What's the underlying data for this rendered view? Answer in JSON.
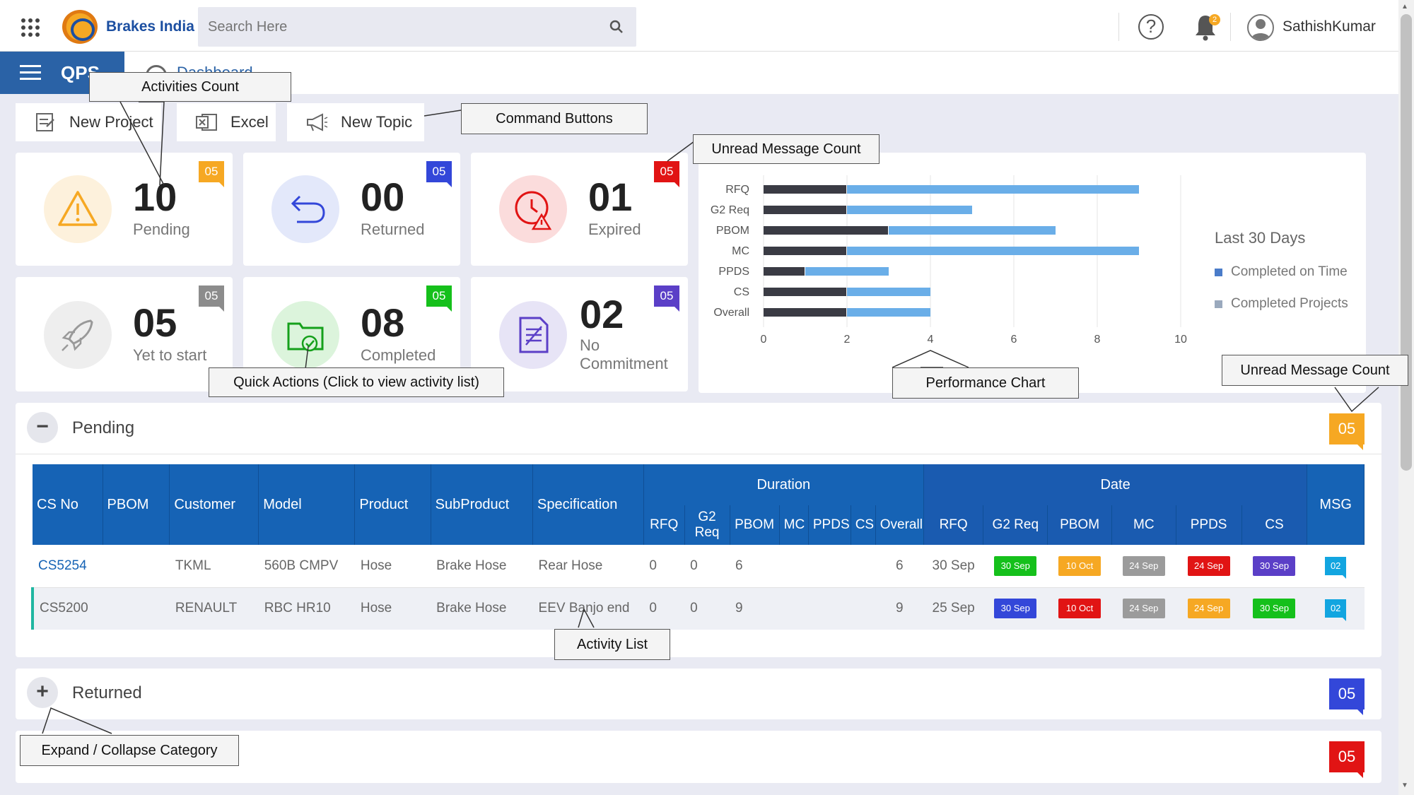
{
  "header": {
    "brand": "Brakes India",
    "search_placeholder": "Search Here",
    "notification_count": "2",
    "user_name": "SathishKumar"
  },
  "subbar": {
    "app_name": "QPS",
    "page_title": "Dashboard"
  },
  "commands": [
    {
      "label": "New Project",
      "icon": "new-project-icon"
    },
    {
      "label": "Excel",
      "icon": "excel-icon"
    },
    {
      "label": "New Topic",
      "icon": "megaphone-icon"
    }
  ],
  "cards": [
    {
      "count": "10",
      "label": "Pending",
      "badge": "05",
      "badge_color": "#f6a823",
      "circle_color": "#fdf1dc",
      "icon": "warning-icon"
    },
    {
      "count": "00",
      "label": "Returned",
      "badge": "05",
      "badge_color": "#3347d9",
      "circle_color": "#e3e8fa",
      "icon": "return-icon"
    },
    {
      "count": "01",
      "label": "Expired",
      "badge": "05",
      "badge_color": "#e11414",
      "circle_color": "#fbdcdc",
      "icon": "expired-clock-icon"
    },
    {
      "count": "05",
      "label": "Yet to start",
      "badge": "05",
      "badge_color": "#8c8c8c",
      "circle_color": "#eeeeee",
      "icon": "rocket-icon"
    },
    {
      "count": "08",
      "label": "Completed",
      "badge": "05",
      "badge_color": "#15c01b",
      "circle_color": "#dcf4dc",
      "icon": "completed-folder-icon"
    },
    {
      "count": "02",
      "label": "No Commitment",
      "badge": "05",
      "badge_color": "#5b3fc7",
      "circle_color": "#e7e4f6",
      "icon": "document-icon"
    }
  ],
  "chart_data": {
    "type": "bar",
    "orientation": "horizontal",
    "stacked": true,
    "categories": [
      "RFQ",
      "G2 Req",
      "PBOM",
      "MC",
      "PPDS",
      "CS",
      "Overall"
    ],
    "series": [
      {
        "name": "Completed on Time",
        "color": "#3a3b44",
        "values": [
          2,
          2,
          3,
          2,
          1,
          2,
          2
        ]
      },
      {
        "name": "Completed Projects",
        "color": "#6aaee8",
        "values": [
          7,
          3,
          4,
          7,
          2,
          2,
          2
        ]
      }
    ],
    "xlim": [
      0,
      10
    ],
    "xticks": [
      0,
      2,
      4,
      6,
      8,
      10
    ],
    "legend_title": "Last 30 Days",
    "legend_placement": "right",
    "grid": true
  },
  "legend": {
    "title": "Last 30 Days",
    "items": [
      "Completed on Time",
      "Completed Projects"
    ],
    "colors": [
      "#4a7cc9",
      "#9aa9bd"
    ]
  },
  "panels": {
    "pending": {
      "title": "Pending",
      "badge": "05",
      "toggle": "−",
      "badge_color": "#f6a823"
    },
    "returned": {
      "title": "Returned",
      "badge": "05",
      "toggle": "+",
      "badge_color": "#3347d9"
    },
    "third": {
      "badge": "05",
      "badge_color": "#e11414"
    }
  },
  "table": {
    "columns": [
      "CS No",
      "PBOM",
      "Customer",
      "Model",
      "Product",
      "SubProduct",
      "Specification"
    ],
    "duration_header": "Duration",
    "date_header": "Date",
    "msg_header": "MSG",
    "duration_cols": [
      "RFQ",
      "G2 Req",
      "PBOM",
      "MC",
      "PPDS",
      "CS",
      "Overall"
    ],
    "date_cols": [
      "RFQ",
      "G2 Req",
      "PBOM",
      "MC",
      "PPDS",
      "CS"
    ],
    "rows": [
      {
        "cs_no": "CS5254",
        "pbom": "",
        "customer": "TKML",
        "model": "560B CMPV",
        "product": "Hose",
        "subproduct": "Brake Hose",
        "spec": "Rear Hose",
        "duration": [
          "0",
          "0",
          "6",
          "",
          "",
          "",
          "6"
        ],
        "date_rfq": "30 Sep",
        "dates": [
          {
            "text": "30 Sep",
            "color": "#15c01b"
          },
          {
            "text": "10 Oct",
            "color": "#f6a823"
          },
          {
            "text": "24 Sep",
            "color": "#9b9b9b"
          },
          {
            "text": "24 Sep",
            "color": "#e11414"
          },
          {
            "text": "30 Sep",
            "color": "#5b3fc7"
          }
        ],
        "msg": "02"
      },
      {
        "cs_no": "CS5200",
        "pbom": "",
        "customer": "RENAULT",
        "model": "RBC HR10",
        "product": "Hose",
        "subproduct": "Brake Hose",
        "spec": "EEV Banjo end",
        "duration": [
          "0",
          "0",
          "9",
          "",
          "",
          "",
          "9"
        ],
        "date_rfq": "25 Sep",
        "dates": [
          {
            "text": "30 Sep",
            "color": "#3347d9"
          },
          {
            "text": "10 Oct",
            "color": "#e11414"
          },
          {
            "text": "24 Sep",
            "color": "#9b9b9b"
          },
          {
            "text": "24 Sep",
            "color": "#f6a823"
          },
          {
            "text": "30 Sep",
            "color": "#15c01b"
          }
        ],
        "msg": "02"
      }
    ]
  },
  "callouts": {
    "activities_count": "Activities Count",
    "command_buttons": "Command Buttons",
    "unread_top": "Unread Message Count",
    "quick_actions": "Quick Actions (Click to view activity list)",
    "performance_chart": "Performance Chart",
    "unread_right": "Unread Message Count",
    "activity_list": "Activity List",
    "expand_collapse": "Expand / Collapse Category"
  }
}
